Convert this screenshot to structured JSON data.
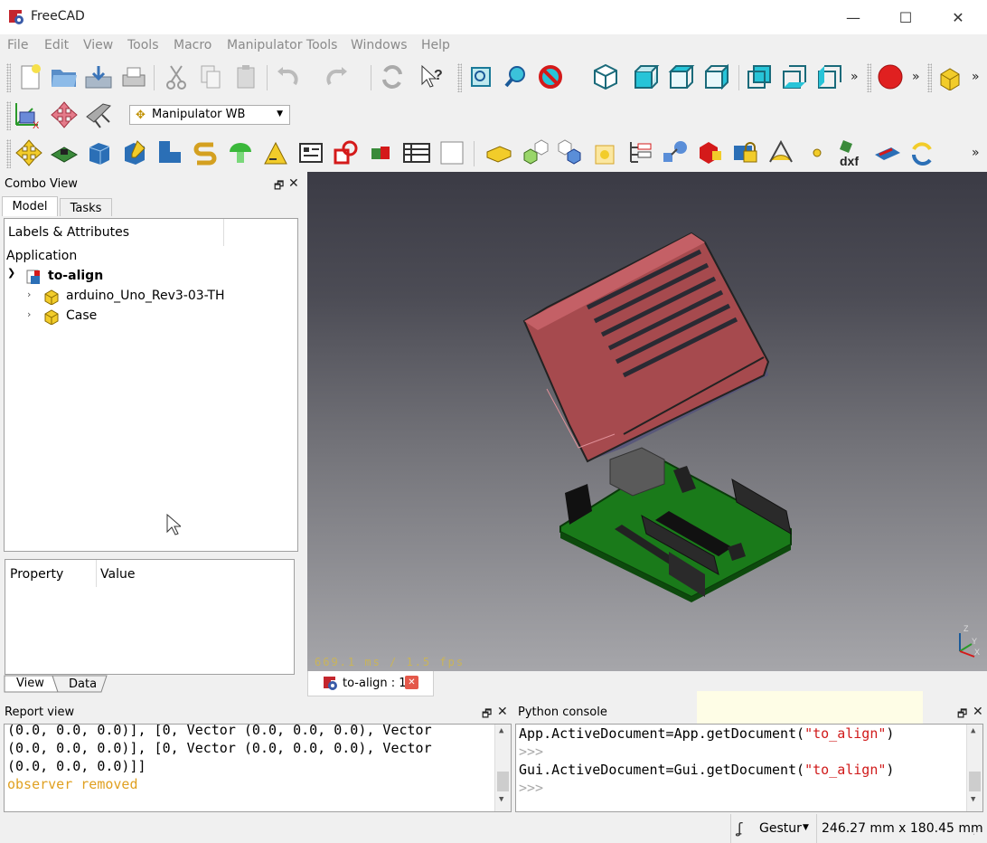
{
  "window": {
    "title": "FreeCAD",
    "minimize": "—",
    "maximize": "☐",
    "close": "✕"
  },
  "menu": [
    "File",
    "Edit",
    "View",
    "Tools",
    "Macro",
    "Manipulator Tools",
    "Windows",
    "Help"
  ],
  "toolbar": {
    "more": "»",
    "workbench_selected": "Manipulator WB"
  },
  "combo_view": {
    "title": "Combo View",
    "tabs": [
      "Model",
      "Tasks"
    ],
    "tree_header": "Labels & Attributes",
    "application": "Application",
    "document": "to-align",
    "items": [
      "arduino_Uno_Rev3-03-TH",
      "Case"
    ],
    "property_header": "Property",
    "value_header": "Value",
    "bottom_tabs": [
      "View",
      "Data"
    ]
  },
  "viewport": {
    "fps_text": "669.1 ms / 1.5 fps"
  },
  "doc_tab": {
    "label": "to-align : 1"
  },
  "report_view": {
    "title": "Report view",
    "lines": [
      "(0.0, 0.0, 0.0)], [0, Vector (0.0, 0.0, 0.0), Vector",
      "(0.0, 0.0, 0.0)], [0, Vector (0.0, 0.0, 0.0), Vector",
      "(0.0, 0.0, 0.0)]]"
    ],
    "warning_line": "observer removed"
  },
  "python_console": {
    "title": "Python console",
    "line1_prefix": "App",
    "line1_mid": ".ActiveDocument=",
    "line1_fn": "App",
    "line1_call": ".getDocument(",
    "line1_arg": "\"to_align\"",
    "line1_end": ")",
    "prompt": ">>>",
    "line2_prefix": "Gui",
    "line2_mid": ".ActiveDocument=",
    "line2_fn": "Gui",
    "line2_call": ".getDocument(",
    "line2_arg": "\"to_align\"",
    "line2_end": ")"
  },
  "statusbar": {
    "nav_style": "Gestur",
    "dimensions": "246.27 mm x 180.45 mm"
  },
  "colors": {
    "accent_red": "#e02020",
    "console_string": "#d01a1a",
    "warning_text": "#e0a020"
  }
}
